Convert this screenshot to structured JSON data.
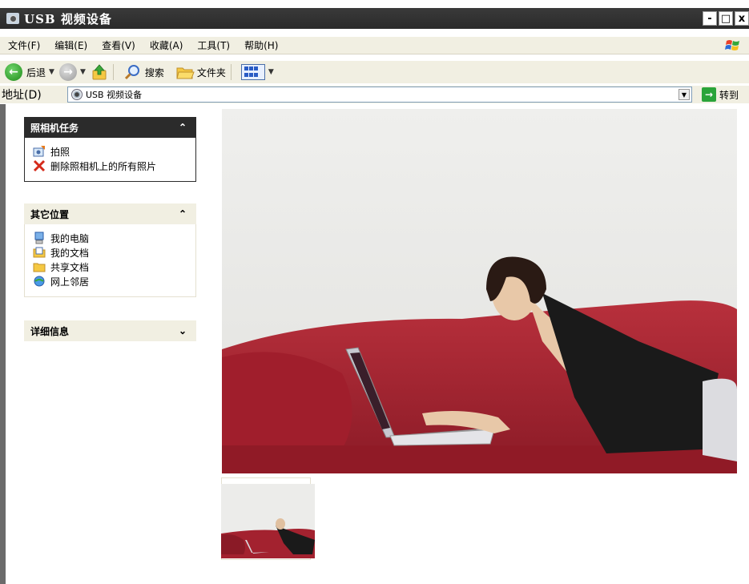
{
  "window": {
    "title": "USB 视频设备"
  },
  "title_controls": {
    "minimize": "-",
    "maximize": "□",
    "close": "x"
  },
  "menu": [
    "文件(F)",
    "编辑(E)",
    "查看(V)",
    "收藏(A)",
    "工具(T)",
    "帮助(H)"
  ],
  "toolbar": {
    "back_label": "后退",
    "search_label": "搜索",
    "folders_label": "文件夹"
  },
  "address": {
    "label": "地址(D)",
    "value": "USB 视频设备",
    "go_label": "转到"
  },
  "panes": [
    {
      "title": "照相机任务",
      "collapse": "⌃",
      "items": [
        {
          "label": "拍照",
          "icon": "take-photo-icon"
        },
        {
          "label": "删除照相机上的所有照片",
          "icon": "delete-icon"
        }
      ]
    },
    {
      "title": "其它位置",
      "collapse": "⌃",
      "items": [
        {
          "label": "我的电脑",
          "icon": "my-computer-icon"
        },
        {
          "label": "我的文档",
          "icon": "my-documents-icon"
        },
        {
          "label": "共享文档",
          "icon": "shared-documents-icon"
        },
        {
          "label": "网上邻居",
          "icon": "network-places-icon"
        }
      ]
    },
    {
      "title": "详细信息",
      "expand": "⌄"
    }
  ],
  "colors": {
    "titlebar": "#2f2f2f",
    "pane_header": "#f1efe2",
    "accent_green": "#2aa43a",
    "sofa": "#a3222f"
  }
}
